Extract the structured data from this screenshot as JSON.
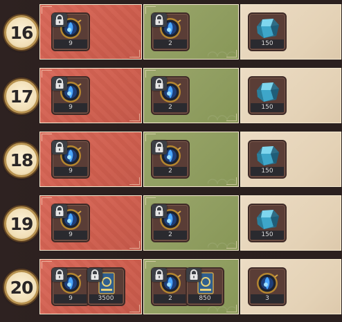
{
  "rows": [
    {
      "level": "16",
      "cells": [
        {
          "items": [
            {
              "icon": "compass-orb-icon",
              "qty": "9",
              "locked": true
            }
          ]
        },
        {
          "items": [
            {
              "icon": "compass-orb-icon",
              "qty": "2",
              "locked": true
            }
          ]
        },
        {
          "items": [
            {
              "icon": "blue-crystal-icon",
              "qty": "150",
              "locked": false
            }
          ]
        }
      ]
    },
    {
      "level": "17",
      "cells": [
        {
          "items": [
            {
              "icon": "compass-orb-icon",
              "qty": "9",
              "locked": true
            }
          ]
        },
        {
          "items": [
            {
              "icon": "compass-orb-icon",
              "qty": "2",
              "locked": true
            }
          ]
        },
        {
          "items": [
            {
              "icon": "blue-crystal-icon",
              "qty": "150",
              "locked": false
            }
          ]
        }
      ]
    },
    {
      "level": "18",
      "cells": [
        {
          "items": [
            {
              "icon": "compass-orb-icon",
              "qty": "9",
              "locked": true
            }
          ]
        },
        {
          "items": [
            {
              "icon": "compass-orb-icon",
              "qty": "2",
              "locked": true
            }
          ]
        },
        {
          "items": [
            {
              "icon": "blue-crystal-icon",
              "qty": "150",
              "locked": false
            }
          ]
        }
      ]
    },
    {
      "level": "19",
      "cells": [
        {
          "items": [
            {
              "icon": "compass-orb-icon",
              "qty": "9",
              "locked": true
            }
          ]
        },
        {
          "items": [
            {
              "icon": "compass-orb-icon",
              "qty": "2",
              "locked": true
            }
          ]
        },
        {
          "items": [
            {
              "icon": "blue-crystal-icon",
              "qty": "150",
              "locked": false
            }
          ]
        }
      ]
    },
    {
      "level": "20",
      "cells": [
        {
          "items": [
            {
              "icon": "compass-orb-icon",
              "qty": "9",
              "locked": true
            },
            {
              "icon": "blue-card-icon",
              "qty": "3500",
              "locked": true
            }
          ]
        },
        {
          "items": [
            {
              "icon": "compass-orb-icon",
              "qty": "2",
              "locked": true
            },
            {
              "icon": "blue-card-icon",
              "qty": "850",
              "locked": true
            }
          ]
        },
        {
          "items": [
            {
              "icon": "compass-orb-icon",
              "qty": "3",
              "locked": false
            }
          ]
        }
      ]
    }
  ],
  "colors": {
    "free_track": "#cf5e4e",
    "premium_track": "#8f9d60",
    "bonus_track": "#e4d2b6",
    "level_badge_ring": "#b79250"
  }
}
